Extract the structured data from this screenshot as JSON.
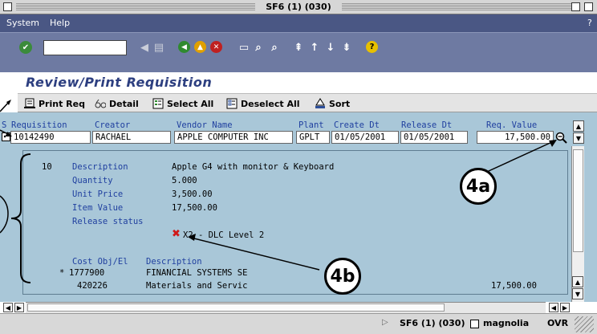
{
  "window": {
    "title": "SF6 (1) (030)"
  },
  "menu": {
    "items": [
      "System",
      "Help"
    ],
    "right_glyph": "?"
  },
  "page": {
    "title": "Review/Print Requisition"
  },
  "toolbar": {
    "buttons": [
      {
        "label": "Print Req",
        "icon": "printer-icon"
      },
      {
        "label": "Detail",
        "icon": "glasses-icon"
      },
      {
        "label": "Select All",
        "icon": "select-all-icon"
      },
      {
        "label": "Deselect All",
        "icon": "deselect-all-icon"
      },
      {
        "label": "Sort",
        "icon": "sort-icon"
      }
    ]
  },
  "table": {
    "headers": [
      "S",
      "Requisition",
      "Creator",
      "Vendor Name",
      "Plant",
      "Create Dt",
      "Release Dt",
      "Req. Value"
    ],
    "row": {
      "requisition": "10142490",
      "creator": "RACHAEL",
      "vendor": "APPLE COMPUTER INC",
      "plant": "GPLT",
      "create_dt": "01/05/2001",
      "release_dt": "01/05/2001",
      "req_value": "17,500.00"
    }
  },
  "detail": {
    "item_no": "10",
    "fields": [
      {
        "label": "Description",
        "value": "Apple G4 with monitor & Keyboard"
      },
      {
        "label": "Quantity",
        "value": "5.000"
      },
      {
        "label": "Unit Price",
        "value": "3,500.00"
      },
      {
        "label": "Item Value",
        "value": "17,500.00"
      },
      {
        "label": "Release status",
        "value": ""
      }
    ],
    "release_status": "X2 - DLC Level 2",
    "cost_header": {
      "col1": "Cost Obj/El",
      "col2": "Description"
    },
    "cost_rows": [
      {
        "marker": "*",
        "obj": "1777900",
        "desc": "FINANCIAL SYSTEMS SE",
        "value": ""
      },
      {
        "marker": "",
        "obj": "420226",
        "desc": "Materials and Servic",
        "value": "17,500.00"
      }
    ]
  },
  "callouts": {
    "a": "4a",
    "b": "4b"
  },
  "status": {
    "session": "SF6 (1) (030)",
    "server": "magnolia",
    "mode": "OVR"
  },
  "colors": {
    "menubar": "#4a5784",
    "toolbar": "#6e7aa2",
    "table_bg": "#a9c7d8",
    "title": "#2d3f80",
    "header_text": "#1f3f9f"
  }
}
